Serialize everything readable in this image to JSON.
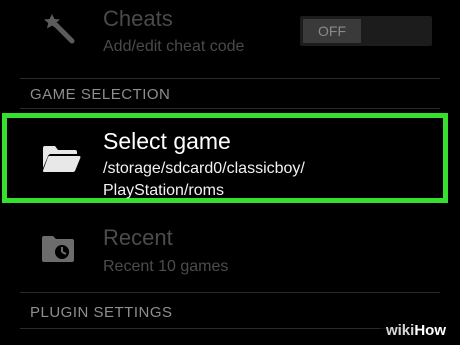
{
  "cheats": {
    "icon": "magic-wand-icon",
    "title": "Cheats",
    "subtitle": "Add/edit cheat code",
    "toggle_label": "OFF"
  },
  "sections": {
    "game_selection": "GAME SELECTION",
    "plugin_settings": "PLUGIN SETTINGS"
  },
  "select_game": {
    "icon": "folder-icon",
    "title": "Select game",
    "path": "/storage/sdcard0/classicboy/\nPlayStation/roms"
  },
  "recent": {
    "icon": "folder-clock-icon",
    "title": "Recent",
    "subtitle": "Recent 10 games"
  },
  "colors": {
    "highlight": "#36e02e",
    "background": "#000000",
    "section_header": "#8e8e8e"
  },
  "watermark": {
    "part1": "wiki",
    "part2": "How"
  }
}
